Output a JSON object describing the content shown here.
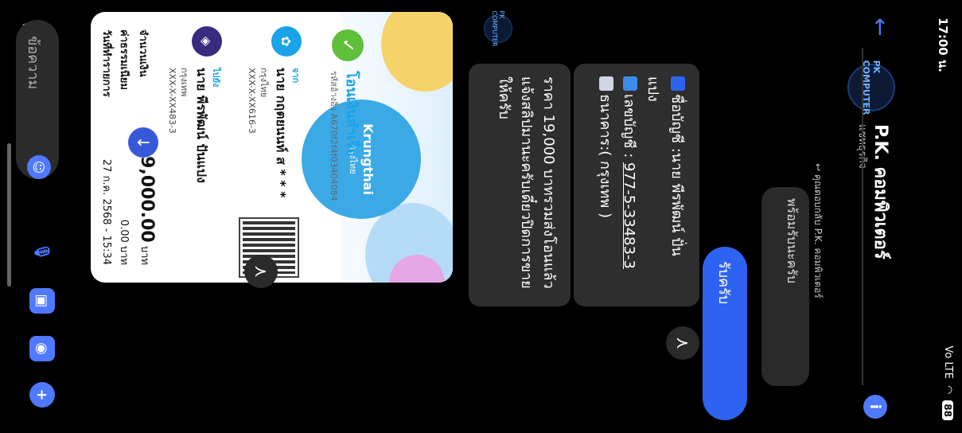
{
  "status": {
    "time": "17:00 น.",
    "battery": "88",
    "signal": "Vo LTE"
  },
  "header": {
    "name": "P.K. คอมพิวเตอร์",
    "subtitle": "แชทธุรกิจ",
    "avatar_text": "PK COMPUTER"
  },
  "chat": {
    "reply_indicator": "คุณตอบกลับ P.K. คอมพิวเตอร์",
    "quote_text": "พร้อมรับนะครับ",
    "my_message": "รับครับ",
    "account_line1": "ชื่อบัญชี :นาย พีรพัฒน์ ปั่น",
    "account_line1b": "แปง",
    "account_line2_prefix": "เลขบัญชี : ",
    "account_number": "977-5-33483-3",
    "account_line3": "ธนาคาร:( กรุงเทพ )",
    "message2": "ราคา 19,000 บาทรวมส่งโอนแล้วแจ้งสลิปมานะครับเดี๋ยวปิดการขายให้ครับ"
  },
  "slip": {
    "brand": "Krungthai",
    "brand_sub": "กรุงไทย",
    "title": "โอนเงินสำเร็จ",
    "ref": "รหัสอ้างอิง A670f2f4f03404084",
    "from_label": "จาก",
    "from_name": "นาย กฤตยนนท์ ส * * *",
    "from_bank": "กรุงไทย",
    "from_acc": "XXX-X-XX616-3",
    "to_label": "ไปยัง",
    "to_name": "นาย พีรพัฒน์ ปันแปง",
    "to_bank": "กรุงเทพ",
    "to_acc": "XXX-X-XX483-3",
    "amount_label": "จำนวนเงิน",
    "amount": "19,000.00",
    "amount_unit": "บาท",
    "fee_label": "ค่าธรรมเนียม",
    "fee": "0.00 บาท",
    "date_label": "วันที่ทำรายการ",
    "date": "27 ก.ค. 2568 - 15:34"
  },
  "composer": {
    "placeholder": "ข้อความ"
  },
  "colors": {
    "accent": "#4f79ff",
    "bubble": "#2e62f0"
  }
}
